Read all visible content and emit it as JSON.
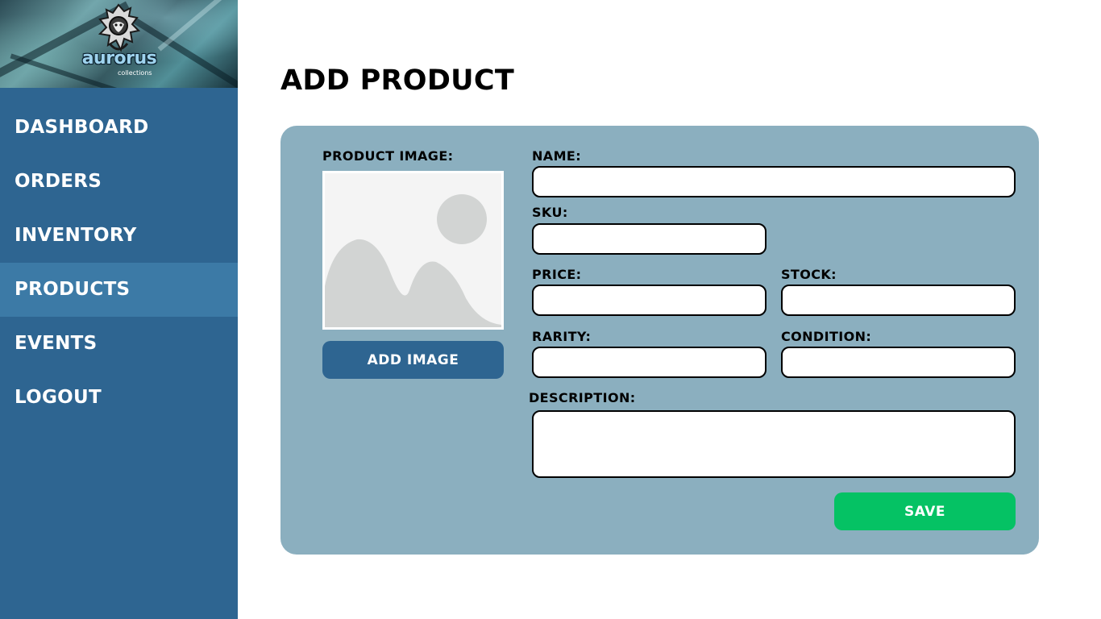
{
  "brand": {
    "logo_word": "aurorus",
    "logo_subtext": "collections"
  },
  "sidebar": {
    "items": [
      {
        "label": "DASHBOARD",
        "active": false
      },
      {
        "label": "ORDERS",
        "active": false
      },
      {
        "label": "INVENTORY",
        "active": false
      },
      {
        "label": "PRODUCTS",
        "active": true
      },
      {
        "label": "EVENTS",
        "active": false
      },
      {
        "label": "LOGOUT",
        "active": false
      }
    ]
  },
  "page": {
    "title": "ADD PRODUCT"
  },
  "form": {
    "product_image_label": "PRODUCT IMAGE:",
    "add_image_label": "ADD IMAGE",
    "name_label": "NAME:",
    "name_value": "",
    "sku_label": "SKU:",
    "sku_value": "",
    "price_label": "PRICE:",
    "price_value": "",
    "stock_label": "STOCK:",
    "stock_value": "",
    "rarity_label": "RARITY:",
    "rarity_value": "",
    "condition_label": "CONDITION:",
    "condition_value": "",
    "description_label": "DESCRIPTION:",
    "description_value": "",
    "save_label": "SAVE"
  },
  "colors": {
    "sidebar": "#2e6591",
    "sidebar_active": "#3c7aa6",
    "card": "#8bafbf",
    "save_button": "#05c264",
    "add_image_button": "#2e6591"
  },
  "icons": {
    "image_placeholder": "image-placeholder-icon",
    "mascot": "dragon-mascot-icon"
  }
}
